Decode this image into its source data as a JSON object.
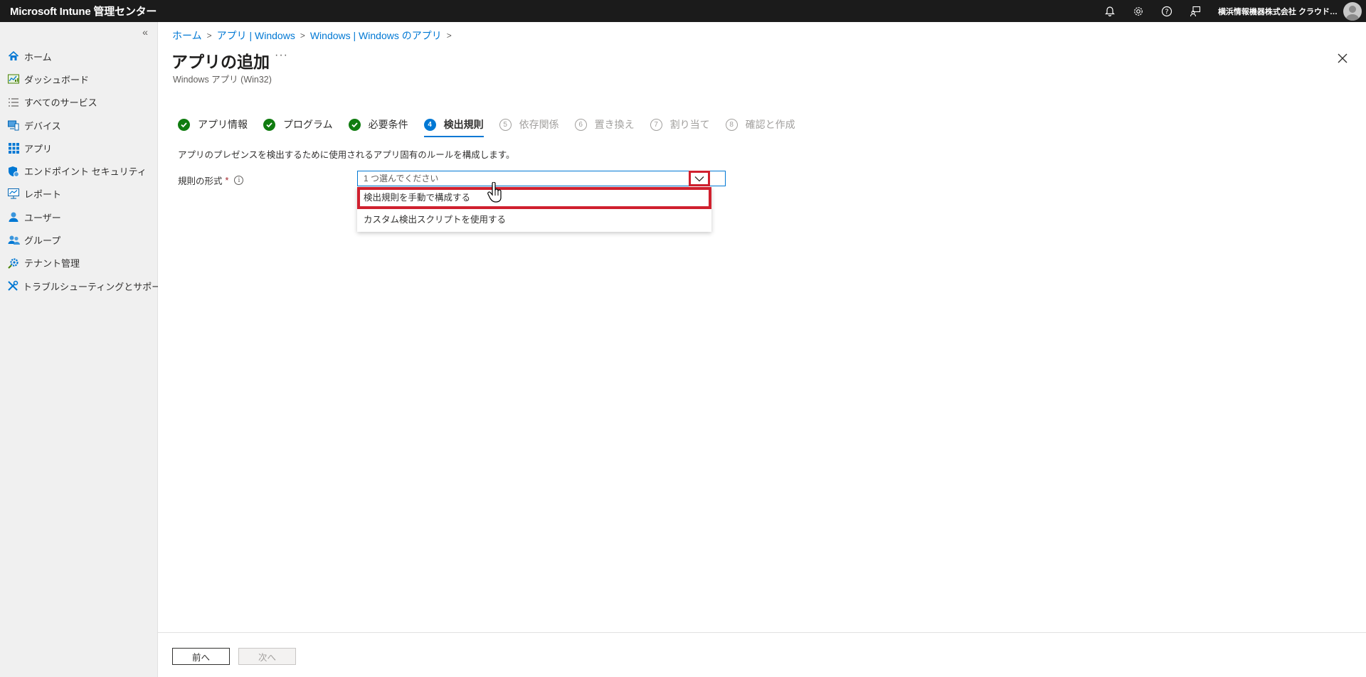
{
  "app": {
    "title": "Microsoft Intune 管理センター",
    "tenant": "横浜情報機器株式会社 クラウド…"
  },
  "header_icons": [
    "bell-icon",
    "gear-icon",
    "help-icon",
    "feedback-icon"
  ],
  "sidebar": {
    "collapse_glyph": "«",
    "items": [
      {
        "label": "ホーム",
        "icon": "home-icon"
      },
      {
        "label": "ダッシュボード",
        "icon": "dashboard-icon"
      },
      {
        "label": "すべてのサービス",
        "icon": "list-icon"
      },
      {
        "label": "デバイス",
        "icon": "devices-icon"
      },
      {
        "label": "アプリ",
        "icon": "apps-grid-icon"
      },
      {
        "label": "エンドポイント セキュリティ",
        "icon": "shield-icon"
      },
      {
        "label": "レポート",
        "icon": "reports-icon"
      },
      {
        "label": "ユーザー",
        "icon": "user-icon"
      },
      {
        "label": "グループ",
        "icon": "group-icon"
      },
      {
        "label": "テナント管理",
        "icon": "tenant-gear-icon"
      },
      {
        "label": "トラブルシューティングとサポート",
        "icon": "tools-icon"
      }
    ]
  },
  "breadcrumb": [
    "ホーム",
    "アプリ | Windows",
    "Windows | Windows のアプリ"
  ],
  "page": {
    "title": "アプリの追加",
    "more": "···",
    "subtitle": "Windows アプリ (Win32)"
  },
  "steps": [
    {
      "label": "アプリ情報",
      "state": "done",
      "num": ""
    },
    {
      "label": "プログラム",
      "state": "done",
      "num": ""
    },
    {
      "label": "必要条件",
      "state": "done",
      "num": ""
    },
    {
      "label": "検出規則",
      "state": "current",
      "num": "4"
    },
    {
      "label": "依存関係",
      "state": "pending",
      "num": "5"
    },
    {
      "label": "置き換え",
      "state": "pending",
      "num": "6"
    },
    {
      "label": "割り当て",
      "state": "pending",
      "num": "7"
    },
    {
      "label": "確認と作成",
      "state": "pending",
      "num": "8"
    }
  ],
  "form": {
    "description": "アプリのプレゼンスを検出するために使用されるアプリ固有のルールを構成します。",
    "rule_format_label": "規則の形式",
    "required_mark": "*",
    "info_glyph": "i",
    "dropdown_placeholder": "1 つ選んでください",
    "options": [
      "検出規則を手動で構成する",
      "カスタム検出スクリプトを使用する"
    ]
  },
  "footer": {
    "prev": "前へ",
    "next": "次へ"
  },
  "colors": {
    "accent": "#0078d4",
    "success": "#107c10",
    "highlight": "#d0202e",
    "topbar": "#1b1b1b"
  }
}
